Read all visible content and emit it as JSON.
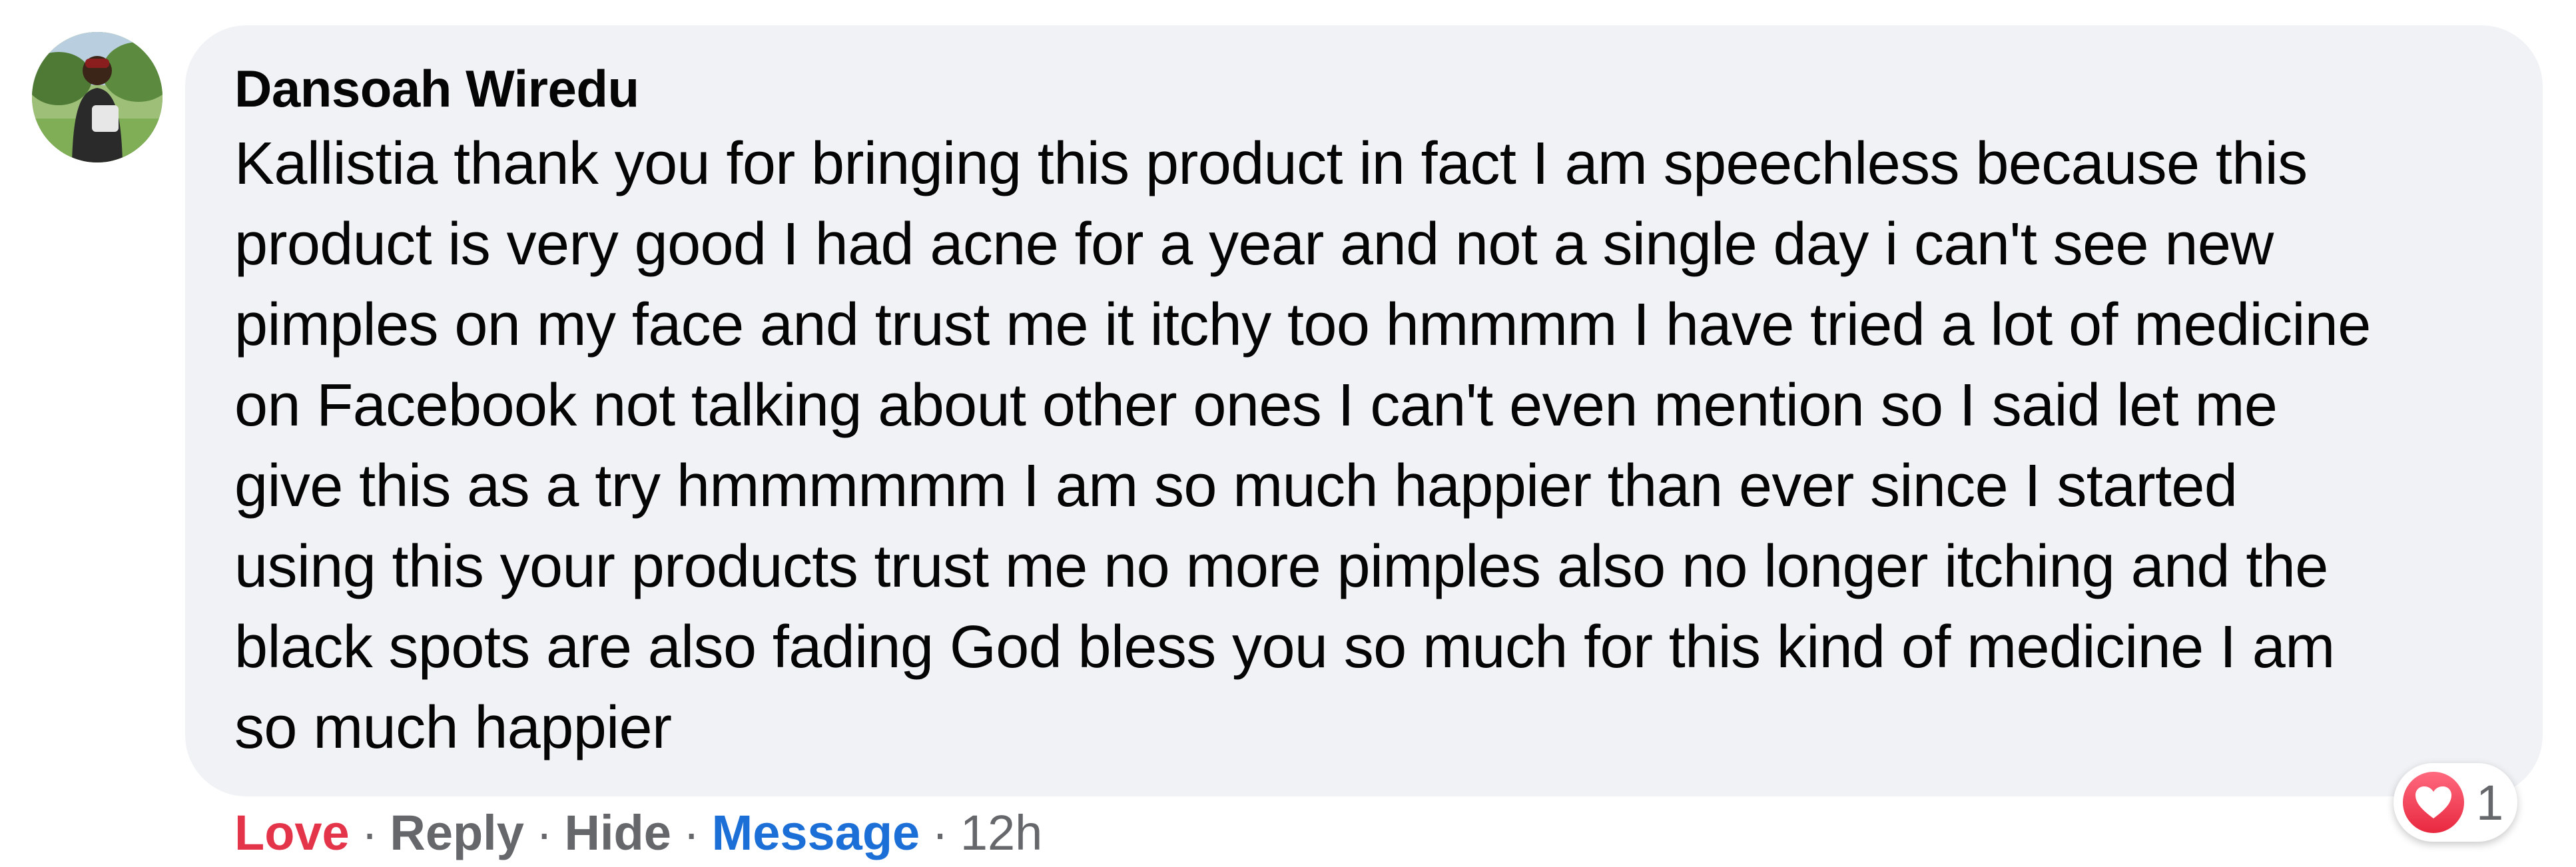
{
  "comment": {
    "author": "Dansoah Wiredu",
    "text": "Kallistia thank you for bringing this product in fact I am speechless because this\nproduct is very good I had acne for a year and not a single day i can't see new\npimples on my face and trust me it itchy too hmmmm I have tried a lot of medicine\non Facebook not talking about other ones I can't even mention so I said let me\ngive this as a try hmmmmmm I am so much happier than ever since I started\nusing this your products trust me no more pimples also no longer itching and the\nblack spots are also fading God bless you so much for this kind of medicine I am\nso much happier"
  },
  "actions": {
    "love": "Love",
    "reply": "Reply",
    "hide": "Hide",
    "message": "Message",
    "separator": "·",
    "time": "12h"
  },
  "reactions": {
    "icon": "heart-icon",
    "count": "1"
  },
  "colors": {
    "bubble": "#f0f2f5",
    "love": "#e4344a",
    "message": "#1b6fd6",
    "muted": "#65676b"
  }
}
